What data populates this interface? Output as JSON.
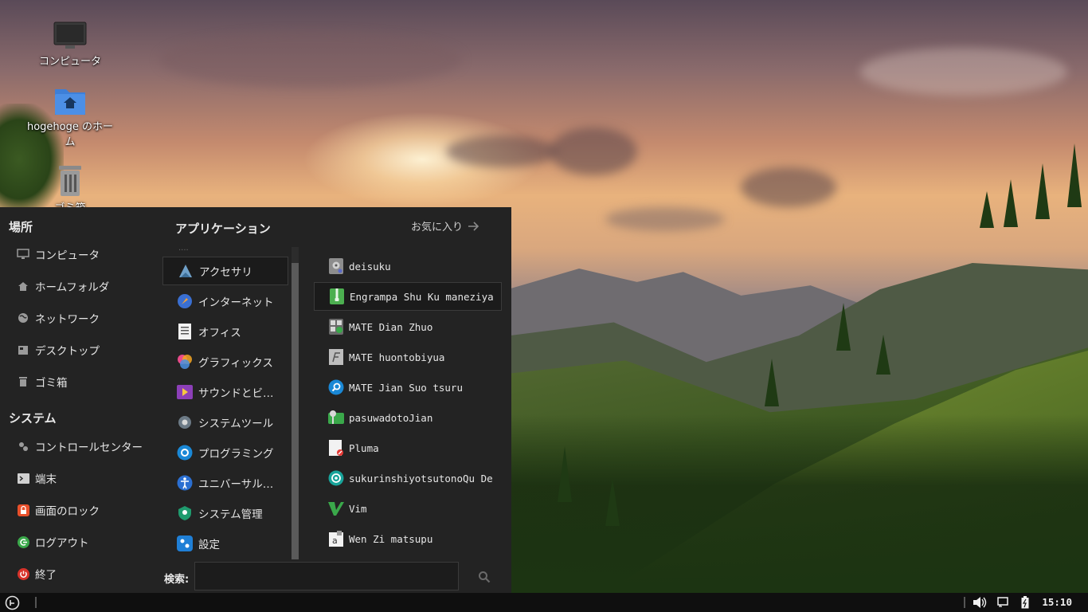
{
  "desktop": {
    "icons": [
      {
        "label": "コンピュータ"
      },
      {
        "label": "hogehoge のホーム"
      },
      {
        "label": "ゴミ箱"
      }
    ]
  },
  "menu": {
    "places_title": "場所",
    "places": [
      {
        "label": "コンピュータ",
        "icon": "monitor-icon"
      },
      {
        "label": "ホームフォルダ",
        "icon": "home-icon"
      },
      {
        "label": "ネットワーク",
        "icon": "globe-icon"
      },
      {
        "label": "デスクトップ",
        "icon": "desktop-icon"
      },
      {
        "label": "ゴミ箱",
        "icon": "trash-icon"
      }
    ],
    "system_title": "システム",
    "system": [
      {
        "label": "コントロールセンター",
        "icon": "settings-icon"
      },
      {
        "label": "端末",
        "icon": "terminal-icon"
      },
      {
        "label": "画面のロック",
        "icon": "lock-icon",
        "color": "#e9502b"
      },
      {
        "label": "ログアウト",
        "icon": "logout-icon",
        "color": "#3aa84a"
      },
      {
        "label": "終了",
        "icon": "power-icon",
        "color": "#d8322a"
      }
    ],
    "applications_title": "アプリケーション",
    "favorites_label": "お気に入り",
    "categories": [
      {
        "label": "アクセサリ",
        "icon": "accessories-icon",
        "selected": true
      },
      {
        "label": "インターネット",
        "icon": "internet-icon"
      },
      {
        "label": "オフィス",
        "icon": "office-icon"
      },
      {
        "label": "グラフィックス",
        "icon": "graphics-icon"
      },
      {
        "label": "サウンドとビ…",
        "icon": "multimedia-icon"
      },
      {
        "label": "システムツール",
        "icon": "system-tools-icon"
      },
      {
        "label": "プログラミング",
        "icon": "programming-icon"
      },
      {
        "label": "ユニバーサル…",
        "icon": "accessibility-icon"
      },
      {
        "label": "システム管理",
        "icon": "admin-icon"
      },
      {
        "label": "設定",
        "icon": "preferences-icon"
      }
    ],
    "apps": [
      {
        "label": "deisuku",
        "icon": "disk-icon"
      },
      {
        "label": "Engrampa Shu Ku maneziya",
        "icon": "archive-icon",
        "selected": true
      },
      {
        "label": "MATE Dian Zhuo",
        "icon": "calculator-icon"
      },
      {
        "label": "MATE huontobiyua",
        "icon": "font-viewer-icon"
      },
      {
        "label": "MATE Jian Suo tsuru",
        "icon": "search-tool-icon"
      },
      {
        "label": "pasuwadotoJian",
        "icon": "password-key-icon"
      },
      {
        "label": "Pluma",
        "icon": "text-editor-icon"
      },
      {
        "label": "sukurinshiyotsutonoQu De",
        "icon": "screenshot-icon"
      },
      {
        "label": "Vim",
        "icon": "vim-icon"
      },
      {
        "label": "Wen Zi matsupu",
        "icon": "charmap-icon"
      }
    ],
    "search_label": "検索:",
    "search_value": ""
  },
  "taskbar": {
    "clock": "15:10"
  }
}
